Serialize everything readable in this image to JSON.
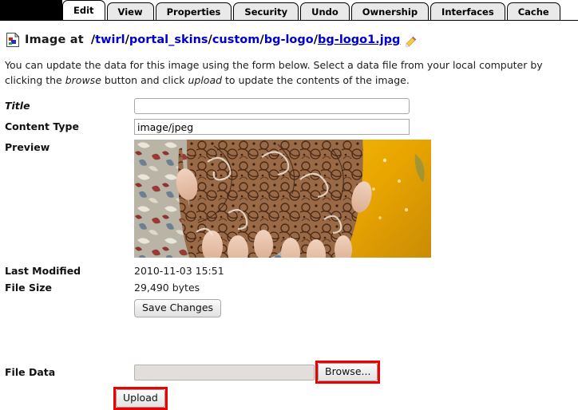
{
  "tabs": [
    {
      "label": "Edit",
      "active": true
    },
    {
      "label": "View",
      "active": false
    },
    {
      "label": "Properties",
      "active": false
    },
    {
      "label": "Security",
      "active": false
    },
    {
      "label": "Undo",
      "active": false
    },
    {
      "label": "Ownership",
      "active": false
    },
    {
      "label": "Interfaces",
      "active": false
    },
    {
      "label": "Cache",
      "active": false
    }
  ],
  "header": {
    "icon": "image-document-icon",
    "title": "Image at",
    "path_segments": [
      "twirl",
      "portal_skins",
      "custom",
      "bg-logo",
      "bg-logo1.jpg"
    ],
    "edit_icon": "pencil-icon"
  },
  "intro": {
    "part1": "You can update the data for this image using the form below. Select a data file from your local computer by clicking the ",
    "em1": "browse",
    "part2": " button and click ",
    "em2": "upload",
    "part3": " to update the contents of the image."
  },
  "form": {
    "title_label": "Title",
    "title_value": "",
    "title_placeholder": "",
    "content_type_label": "Content Type",
    "content_type_value": "image/jpeg",
    "preview_label": "Preview",
    "preview_alt": "henna decorated hands photograph",
    "last_modified_label": "Last Modified",
    "last_modified_value": "2010-11-03 15:51",
    "file_size_label": "File Size",
    "file_size_value": "29,490 bytes",
    "save_label": "Save Changes",
    "file_data_label": "File Data",
    "file_value": "",
    "browse_label": "Browse...",
    "upload_label": "Upload"
  },
  "colors": {
    "link": "#0000cc",
    "highlight": "#ee0000",
    "tab_inactive": "#e9e9e9",
    "tab_active": "#ffffff",
    "black_bar": "#000000"
  }
}
